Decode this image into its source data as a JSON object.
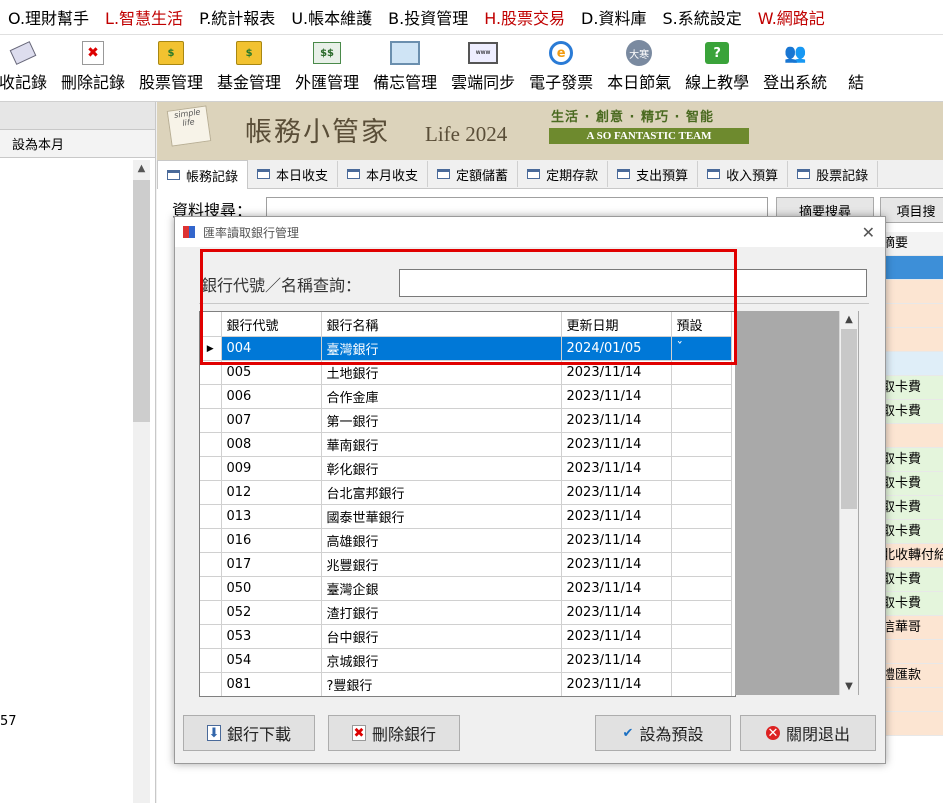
{
  "menu": [
    "O.理財幫手",
    "L.智慧生活",
    "P.統計報表",
    "U.帳本維護",
    "B.投資管理",
    "H.股票交易",
    "D.資料庫",
    "S.系統設定",
    "W.網路記"
  ],
  "menu_red": [
    false,
    true,
    false,
    false,
    false,
    true,
    false,
    false,
    true
  ],
  "toolbar": {
    "items": [
      {
        "label": "收記錄",
        "icon": "eraser-icon"
      },
      {
        "label": "刪除記錄",
        "icon": "delete-doc-icon"
      },
      {
        "label": "股票管理",
        "icon": "coin-icon"
      },
      {
        "label": "基金管理",
        "icon": "coin-icon"
      },
      {
        "label": "外匯管理",
        "icon": "money-icon"
      },
      {
        "label": "備忘管理",
        "icon": "monitor-icon"
      },
      {
        "label": "雲端同步",
        "icon": "laptop-icon"
      },
      {
        "label": "電子發票",
        "icon": "ie-icon"
      },
      {
        "label": "本日節氣",
        "icon": "moon-icon"
      },
      {
        "label": "線上教學",
        "icon": "help-icon"
      },
      {
        "label": "登出系統",
        "icon": "users-icon"
      },
      {
        "label": "結",
        "icon": "blank-icon"
      }
    ],
    "icon_text": {
      "coin": "$",
      "money": "$$",
      "ie": "e",
      "moon": "大寒",
      "help": "?",
      "del": "✖",
      "laptop": "www"
    }
  },
  "left_panel": {
    "tab_label": "設為本月",
    "number": "57"
  },
  "banner": {
    "note": "simple life",
    "title": "帳務小管家",
    "life": "Life 2024",
    "slogan": "生活 · 創意 · 精巧 · 智能",
    "team": "A SO FANTASTIC TEAM"
  },
  "tabs": [
    "帳務記錄",
    "本日收支",
    "本月收支",
    "定額儲蓄",
    "定期存款",
    "支出預算",
    "收入預算",
    "股票記錄"
  ],
  "main": {
    "search_label": "資料搜尋：",
    "summary_search": "摘要搜尋",
    "item_search": "項目搜",
    "right_column": [
      {
        "text": "摘要",
        "style": "head"
      },
      {
        "text": "",
        "style": "sel"
      },
      {
        "text": "",
        "style": "peach"
      },
      {
        "text": "",
        "style": "peach"
      },
      {
        "text": "",
        "style": "peach"
      },
      {
        "text": "",
        "style": "blue"
      },
      {
        "text": "取卡費",
        "style": "green"
      },
      {
        "text": "取卡費",
        "style": "green"
      },
      {
        "text": "",
        "style": "peach"
      },
      {
        "text": "取卡費",
        "style": "green"
      },
      {
        "text": "取卡費",
        "style": "green"
      },
      {
        "text": "取卡費",
        "style": "green"
      },
      {
        "text": "取卡費",
        "style": "green"
      },
      {
        "text": "北收轉付給",
        "style": "peach"
      },
      {
        "text": "取卡費",
        "style": "green"
      },
      {
        "text": "取卡費",
        "style": "green"
      },
      {
        "text": "信華哥",
        "style": "peach"
      },
      {
        "text": "",
        "style": "peach"
      },
      {
        "text": "禮匯款",
        "style": "peach"
      },
      {
        "text": "",
        "style": "peach"
      },
      {
        "text": "",
        "style": "peach"
      }
    ]
  },
  "dialog": {
    "title": "匯率讀取銀行管理",
    "close": "✕",
    "query_label": "銀行代號／名稱查詢：",
    "query_value": "",
    "columns": [
      "銀行代號",
      "銀行名稱",
      "更新日期",
      "預設"
    ],
    "selected_marker": "▶",
    "rows": [
      {
        "code": "004",
        "name": "臺灣銀行",
        "date": "2024/01/05",
        "default": "ˇ",
        "selected": true
      },
      {
        "code": "005",
        "name": "土地銀行",
        "date": "2023/11/14",
        "default": "",
        "selected": false
      },
      {
        "code": "006",
        "name": "合作金庫",
        "date": "2023/11/14",
        "default": "",
        "selected": false
      },
      {
        "code": "007",
        "name": "第一銀行",
        "date": "2023/11/14",
        "default": "",
        "selected": false
      },
      {
        "code": "008",
        "name": "華南銀行",
        "date": "2023/11/14",
        "default": "",
        "selected": false
      },
      {
        "code": "009",
        "name": "彰化銀行",
        "date": "2023/11/14",
        "default": "",
        "selected": false
      },
      {
        "code": "012",
        "name": "台北富邦銀行",
        "date": "2023/11/14",
        "default": "",
        "selected": false
      },
      {
        "code": "013",
        "name": "國泰世華銀行",
        "date": "2023/11/14",
        "default": "",
        "selected": false
      },
      {
        "code": "016",
        "name": "高雄銀行",
        "date": "2023/11/14",
        "default": "",
        "selected": false
      },
      {
        "code": "017",
        "name": "兆豐銀行",
        "date": "2023/11/14",
        "default": "",
        "selected": false
      },
      {
        "code": "050",
        "name": "臺灣企銀",
        "date": "2023/11/14",
        "default": "",
        "selected": false
      },
      {
        "code": "052",
        "name": "渣打銀行",
        "date": "2023/11/14",
        "default": "",
        "selected": false
      },
      {
        "code": "053",
        "name": "台中銀行",
        "date": "2023/11/14",
        "default": "",
        "selected": false
      },
      {
        "code": "054",
        "name": "京城銀行",
        "date": "2023/11/14",
        "default": "",
        "selected": false
      },
      {
        "code": "081",
        "name": "?豐銀行",
        "date": "2023/11/14",
        "default": "",
        "selected": false
      }
    ],
    "buttons": {
      "download": "銀行下載",
      "delete": "刪除銀行",
      "set_default": "設為預設",
      "close": "關閉退出"
    }
  },
  "colors": {
    "highlight": "#e00000",
    "selection": "#0078d7",
    "menu_red": "#c00000"
  }
}
